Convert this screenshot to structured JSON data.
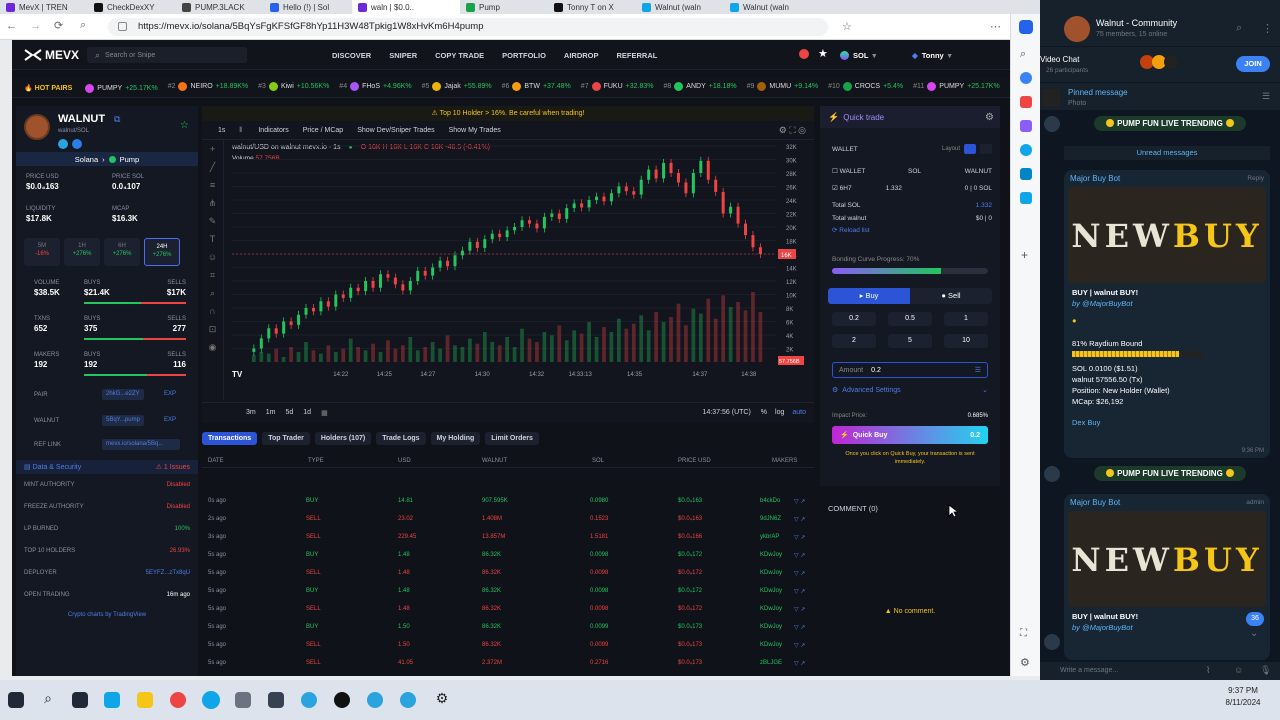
{
  "browser": {
    "tabs": [
      {
        "title": "MevX | TREN",
        "color": "#6d28d9"
      },
      {
        "title": "CheckDexXY",
        "color": "#111111"
      },
      {
        "title": "PUMP.3LACK",
        "color": "#444444"
      },
      {
        "title": "Hello (!) | Sol",
        "color": "#2563eb"
      },
      {
        "title": "waln | $0.0..",
        "color": "#6d28d9"
      },
      {
        "title": "Pump",
        "color": "#16a34a"
      },
      {
        "title": "Tonny T on X",
        "color": "#111111"
      },
      {
        "title": "Walnut (waln",
        "color": "#0ea5e9"
      },
      {
        "title": "Walnut (waln",
        "color": "#0ea5e9"
      }
    ],
    "url": "https://mevx.io/solana/5BqYsFgKFSfGF8hYp11H3W48Tpkig1W8xHvKm6H4pump"
  },
  "nav": {
    "logo": "MEVX",
    "search_placeholder": "Search or Snipe",
    "links": [
      "DISCOVER",
      "SNIPER",
      "COPY TRADE",
      "PORTFOLIO",
      "AIRDROP",
      "REFERRAL"
    ],
    "chain": "SOL",
    "user": "Tonny"
  },
  "ticker": {
    "label": "HOT PAIRS",
    "items": [
      {
        "rank": "",
        "name": "PUMPY",
        "pct": "+25.17K%",
        "color": "#d946ef"
      },
      {
        "rank": "#2",
        "name": "NEIRO",
        "pct": "+18.89K%",
        "color": "#f97316"
      },
      {
        "rank": "#3",
        "name": "Kiwi",
        "pct": "+10.56K%",
        "color": "#84cc16"
      },
      {
        "rank": "#4",
        "name": "FHoS",
        "pct": "+4.96K%",
        "color": "#a855f7"
      },
      {
        "rank": "#5",
        "name": "Jajak",
        "pct": "+55.89%",
        "color": "#eab308"
      },
      {
        "rank": "#6",
        "name": "BTW",
        "pct": "+37.48%",
        "color": "#f59e0b"
      },
      {
        "rank": "#7",
        "name": "FUKU",
        "pct": "+32.83%",
        "color": "#ef4444"
      },
      {
        "rank": "#8",
        "name": "ANDY",
        "pct": "+18.18%",
        "color": "#22c55e"
      },
      {
        "rank": "#9",
        "name": "MUMU",
        "pct": "+9.14%",
        "color": "#a16207"
      },
      {
        "rank": "#10",
        "name": "CROCS",
        "pct": "+5.4%",
        "color": "#16a34a"
      },
      {
        "rank": "#11",
        "name": "PUMPY",
        "pct": "+25.17K%",
        "color": "#d946ef"
      }
    ]
  },
  "token": {
    "name": "WALNUT",
    "pair": "walnut/SOL",
    "chain": "Solana",
    "dex": "Pump",
    "price_usd_label": "PRICE USD",
    "price_usd": "$0.0₄163",
    "price_sol_label": "PRICE SOL",
    "price_sol": "0.0₄107",
    "liquidity_label": "LIQUIDITY",
    "liquidity": "$17.8K",
    "mcap_label": "MCAP",
    "mcap": "$16.3K",
    "timeframes": [
      {
        "label": "5M",
        "value": "-16%",
        "up": false
      },
      {
        "label": "1H",
        "value": "+276%",
        "up": true
      },
      {
        "label": "6H",
        "value": "+276%",
        "up": true
      },
      {
        "label": "24H",
        "value": "+276%",
        "up": true
      }
    ],
    "volume_label": "VOLUME",
    "volume": "$38.5K",
    "vol_buys_label": "BUYS",
    "vol_buys": "$21.4K",
    "vol_sells_label": "SELLS",
    "vol_sells": "$17K",
    "vol_buy_ratio": 0.56,
    "txns_label": "TXNS",
    "txns": "652",
    "txn_buys_label": "BUYS",
    "txn_buys": "375",
    "txn_sells_label": "SELLS",
    "txn_sells": "277",
    "txn_buy_ratio": 0.58,
    "makers_label": "MAKERS",
    "makers": "192",
    "mk_buys_label": "BUYS",
    "mk_buys": "192",
    "mk_sells_label": "SELLS",
    "mk_sells": "116",
    "mk_buy_ratio": 0.62,
    "pair_label": "PAIR",
    "pair_addr": "2hkG...e2ZY",
    "walnut_label": "WALNUT",
    "walnut_addr": "5BqY...pump",
    "ref_label": "REF LINK",
    "ref_link": "mevx.io/solana/5Bq...",
    "exp": "EXP",
    "security_label": "Data & Security",
    "issues": "1 Issues",
    "security": [
      {
        "k": "MINT AUTHORITY",
        "v": "Disabled",
        "c": "#ef4444"
      },
      {
        "k": "FREEZE AUTHORITY",
        "v": "Disabled",
        "c": "#ef4444"
      },
      {
        "k": "LP BURNED",
        "v": "100%",
        "c": "#22c55e"
      },
      {
        "k": "TOP 10 HOLDERS",
        "v": "26.93%",
        "c": "#ef4444"
      },
      {
        "k": "DEPLOYER",
        "v": "5EYFZ...zTx8qU",
        "c": "#4f7ee8"
      },
      {
        "k": "OPEN TRADING",
        "v": "16m ago",
        "c": "#ffffff"
      }
    ],
    "charts_by": "Crypto charts by TradingView"
  },
  "chart": {
    "warning": "Top 10 Holder > 16%. Be careful when trading!",
    "interval": "1s",
    "tools": [
      "Indicators",
      "Price / MCap",
      "Show Dev/Sniper Trades",
      "Show My Trades"
    ],
    "legend": "walnut/USD on walnut mevx.io · 1s",
    "ohlc": "O 16K  H 16K  L 16K  C 16K  -46.5 (-0.41%)",
    "volume_label": "Volume",
    "volume_value": "57.756B",
    "ranges": [
      "3m",
      "1m",
      "5d",
      "1d"
    ],
    "clock": "14:37:56 (UTC)",
    "pct": "%",
    "log": "log",
    "auto": "auto",
    "y_ticks": [
      "32K",
      "30K",
      "28K",
      "26K",
      "24K",
      "22K",
      "20K",
      "18K",
      "16K",
      "14K",
      "12K",
      "10K",
      "8K",
      "6K",
      "4K",
      "2K"
    ],
    "last_price": "16K",
    "vol_badge": "57.756B",
    "x_ticks": [
      "14:22",
      "14:25",
      "14:27",
      "14:30",
      "14:32",
      "14:33:13",
      "14:35",
      "14:37",
      "14:38"
    ],
    "tv_logo": "TV"
  },
  "chart_data": {
    "type": "candlestick",
    "ylim": [
      0,
      32
    ],
    "yunit": "K",
    "x_start": "14:20",
    "x_end": "14:38",
    "closes": [
      2,
      3.5,
      5,
      4.2,
      6,
      5.5,
      7,
      8,
      7.5,
      9,
      8.2,
      10,
      9.5,
      11,
      10.5,
      12,
      11,
      13,
      12.5,
      11.5,
      10.6,
      12,
      13.5,
      12.8,
      14,
      15,
      14.2,
      15.8,
      16.5,
      17.8,
      16.9,
      18.2,
      19,
      18.5,
      19.5,
      20,
      21,
      20.5,
      19.8,
      21.5,
      22,
      21.2,
      22.8,
      23.5,
      22.9,
      24,
      24.5,
      23.8,
      25,
      26,
      25.3,
      24.8,
      27,
      28.5,
      27.2,
      29.5,
      28,
      26.6,
      25,
      28,
      29.8,
      27,
      25.2,
      22,
      23,
      20.5,
      18.8,
      17,
      16
    ],
    "volumes": [
      4,
      6,
      5,
      8,
      3,
      9,
      6,
      12,
      7,
      5,
      10,
      6,
      8,
      14,
      9,
      7,
      11,
      6,
      13,
      8,
      10,
      15,
      7,
      9,
      12,
      8,
      16,
      10,
      9,
      14,
      11,
      18,
      12,
      10,
      15,
      9,
      20,
      14,
      12,
      18,
      16,
      22,
      13,
      19,
      17,
      24,
      15,
      21,
      18,
      26,
      20,
      23,
      28,
      19,
      30,
      24,
      27,
      35,
      22,
      32,
      29,
      38,
      26,
      40,
      33,
      36,
      31,
      42,
      30
    ]
  },
  "table": {
    "tabs": [
      "Transactions",
      "Top Trader",
      "Holders (107)",
      "Trade Logs",
      "My Holding",
      "Limit Orders"
    ],
    "headers": [
      "DATE",
      "TYPE",
      "USD",
      "WALNUT",
      "SOL",
      "PRICE USD",
      "MAKERS"
    ],
    "rows": [
      {
        "date": "0s ago",
        "type": "BUY",
        "usd": "14.81",
        "walnut": "907.595K",
        "sol": "0.0980",
        "price": "$0.0₄163",
        "maker": "b4ckDo"
      },
      {
        "date": "2s ago",
        "type": "SELL",
        "usd": "23.02",
        "walnut": "1.408M",
        "sol": "0.1523",
        "price": "$0.0₄163",
        "maker": "9dJN6Z"
      },
      {
        "date": "3s ago",
        "type": "SELL",
        "usd": "229.45",
        "walnut": "13.857M",
        "sol": "1.5181",
        "price": "$0.0₄166",
        "maker": "ykbrAP"
      },
      {
        "date": "5s ago",
        "type": "BUY",
        "usd": "1.48",
        "walnut": "86.32K",
        "sol": "0.0098",
        "price": "$0.0₄172",
        "maker": "KDwJoy"
      },
      {
        "date": "5s ago",
        "type": "SELL",
        "usd": "1.48",
        "walnut": "86.32K",
        "sol": "0.0098",
        "price": "$0.0₄172",
        "maker": "KDwJoy"
      },
      {
        "date": "5s ago",
        "type": "BUY",
        "usd": "1.48",
        "walnut": "86.32K",
        "sol": "0.0098",
        "price": "$0.0₄172",
        "maker": "KDwJoy"
      },
      {
        "date": "5s ago",
        "type": "SELL",
        "usd": "1.48",
        "walnut": "86.32K",
        "sol": "0.0098",
        "price": "$0.0₄172",
        "maker": "KDwJoy"
      },
      {
        "date": "5s ago",
        "type": "BUY",
        "usd": "1.50",
        "walnut": "86.32K",
        "sol": "0.0099",
        "price": "$0.0₄173",
        "maker": "KDwJoy"
      },
      {
        "date": "5s ago",
        "type": "SELL",
        "usd": "1.50",
        "walnut": "86.32K",
        "sol": "0.0099",
        "price": "$0.0₄173",
        "maker": "KDwJoy"
      },
      {
        "date": "5s ago",
        "type": "SELL",
        "usd": "41.05",
        "walnut": "2.372M",
        "sol": "0.2716",
        "price": "$0.0₄173",
        "maker": "zBLJGE"
      }
    ]
  },
  "quicktrade": {
    "title": "Quick trade",
    "wallet_label": "WALLET",
    "layout_label": "Layout",
    "cols": [
      "WALLET",
      "SOL",
      "WALNUT"
    ],
    "wallet_name": "6H7",
    "wallet_sol": "1.332",
    "wallet_walnut": "0 | 0 SOL",
    "total_sol_label": "Total SOL",
    "total_sol": "1.332",
    "total_walnut_label": "Total walnut",
    "total_walnut": "$0 | 0",
    "reload": "Reload list",
    "bonding_label": "Bonding Curve Progress: 70%",
    "bonding": 0.7,
    "buy": "Buy",
    "sell": "Sell",
    "presets": [
      "0.2",
      "0.5",
      "1",
      "2",
      "5",
      "10"
    ],
    "amount_label": "Amount",
    "amount": "0.2",
    "advanced": "Advanced Settings",
    "impact_label": "Impact Price:",
    "impact": "0.685%",
    "quick_buy": "Quick Buy",
    "quick_buy_amt": "0.2",
    "note": "Once you click on Quick Buy, your transaction is sent immediately."
  },
  "comments": {
    "title": "COMMENT (0)",
    "empty": "No comment."
  },
  "telegram": {
    "group": "Walnut - Community",
    "members": "75 members, 15 online",
    "video_chat": "Video Chat",
    "participants": "26 participants",
    "join": "JOIN",
    "pinned_label": "Pinned message",
    "pinned_text": "Photo",
    "trending": "PUMP FUN LIVE TRENDING",
    "unread": "Unread messages",
    "bot": "Major Buy Bot",
    "reply": "Reply",
    "admin": "admin",
    "banner_a": "NEW",
    "banner_b": "BUY",
    "buy_line": "BUY | walnut BUY!",
    "by": "by @MajorBuyBot",
    "raydium": "81% Raydium Bound",
    "raydium_progress": 0.81,
    "sol_line": "SOL 0.0100 ($1.51)",
    "walnut_line": "walnut 57556.50 (Tx)",
    "position": "Position: New Holder (Wallet)",
    "mcap": "MCap: $26,192",
    "links": "Dex  Buy",
    "time": "9:36 PM",
    "badge": "36",
    "input_placeholder": "Write a message..."
  },
  "taskbar": {
    "time": "9:37 PM",
    "date": "8/11/2024"
  }
}
